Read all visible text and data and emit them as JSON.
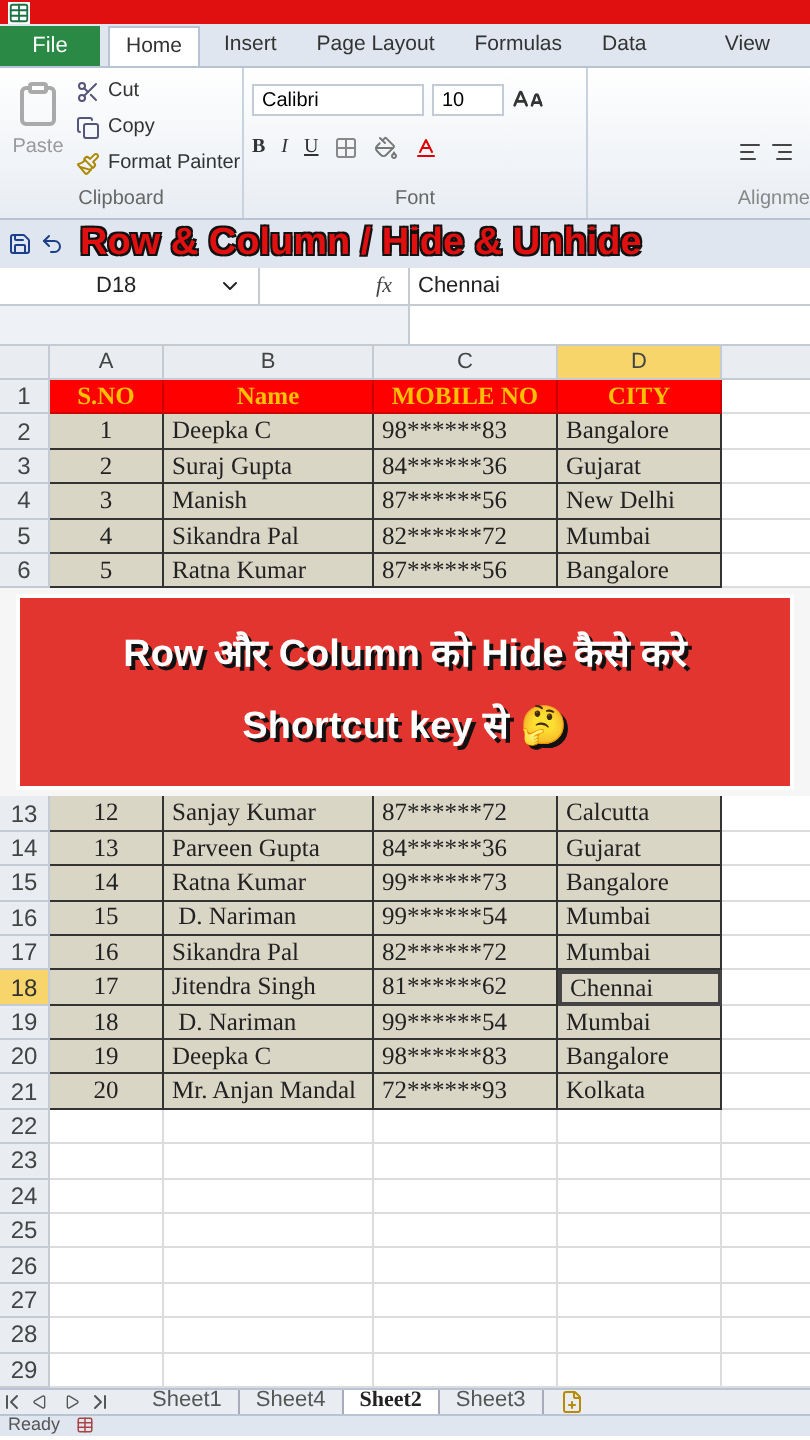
{
  "ribbon": {
    "tabs": [
      {
        "label": "File",
        "kind": "file",
        "selected": false
      },
      {
        "label": "Home",
        "kind": "tab",
        "selected": true
      },
      {
        "label": "Insert",
        "kind": "tab",
        "selected": false
      },
      {
        "label": "Page Layout",
        "kind": "tab",
        "selected": false
      },
      {
        "label": "Formulas",
        "kind": "tab",
        "selected": false
      },
      {
        "label": "Data",
        "kind": "tab",
        "selected": false
      },
      {
        "label": "View",
        "kind": "tab",
        "selected": false
      }
    ],
    "clipboard": {
      "paste": "Paste",
      "cut": "Cut",
      "copy": "Copy",
      "format_painter": "Format Painter",
      "label": "Clipboard"
    },
    "font": {
      "name": "Calibri",
      "size": "10",
      "bold": "B",
      "italic": "I",
      "underline": "U",
      "label": "Font"
    },
    "alignment_label": "Alignme"
  },
  "video_title": "Row & Column / Hide & Unhide",
  "formula_bar": {
    "name_box": "D18",
    "fx": "fx",
    "value": "Chennai"
  },
  "columns": [
    {
      "label": "A",
      "selected": false
    },
    {
      "label": "B",
      "selected": false
    },
    {
      "label": "C",
      "selected": false
    },
    {
      "label": "D",
      "selected": true
    }
  ],
  "rows_top": [
    {
      "number": "1",
      "kind": "header",
      "selected": false,
      "cells": [
        "S.NO",
        "Name",
        "MOBILE NO",
        "CITY"
      ]
    },
    {
      "number": "2",
      "kind": "data",
      "selected": false,
      "cells": [
        "1",
        "Deepka C",
        "98******83",
        "Bangalore"
      ]
    },
    {
      "number": "3",
      "kind": "data",
      "selected": false,
      "cells": [
        "2",
        "Suraj Gupta",
        "84******36",
        "Gujarat"
      ]
    },
    {
      "number": "4",
      "kind": "data",
      "selected": false,
      "cells": [
        "3",
        "Manish",
        "87******56",
        "New Delhi"
      ]
    },
    {
      "number": "5",
      "kind": "data",
      "selected": false,
      "cells": [
        "4",
        "Sikandra Pal",
        "82******72",
        "Mumbai"
      ]
    },
    {
      "number": "6",
      "kind": "data",
      "selected": false,
      "cells": [
        "5",
        "Ratna Kumar",
        "87******56",
        "Bangalore"
      ]
    }
  ],
  "banner": {
    "line_1": "Row और Column को Hide कैसे करे",
    "line_2": "Shortcut key से 🤔"
  },
  "rows_bottom": [
    {
      "number": "13",
      "kind": "data",
      "selected": false,
      "cells": [
        "12",
        "Sanjay Kumar",
        "87******72",
        "Calcutta"
      ]
    },
    {
      "number": "14",
      "kind": "data",
      "selected": false,
      "cells": [
        "13",
        "Parveen Gupta",
        "84******36",
        "Gujarat"
      ]
    },
    {
      "number": "15",
      "kind": "data",
      "selected": false,
      "cells": [
        "14",
        "Ratna Kumar",
        "99******73",
        "Bangalore"
      ]
    },
    {
      "number": "16",
      "kind": "data",
      "selected": false,
      "cells": [
        "15",
        " D. Nariman",
        "99******54",
        "Mumbai"
      ]
    },
    {
      "number": "17",
      "kind": "data",
      "selected": false,
      "cells": [
        "16",
        "Sikandra Pal",
        "82******72",
        "Mumbai"
      ]
    },
    {
      "number": "18",
      "kind": "data",
      "selected": true,
      "cells": [
        "17",
        "Jitendra Singh",
        "81******62",
        "Chennai"
      ]
    },
    {
      "number": "19",
      "kind": "data",
      "selected": false,
      "cells": [
        "18",
        " D. Nariman",
        "99******54",
        "Mumbai"
      ]
    },
    {
      "number": "20",
      "kind": "data",
      "selected": false,
      "cells": [
        "19",
        "Deepka C",
        "98******83",
        "Bangalore"
      ]
    },
    {
      "number": "21",
      "kind": "data",
      "selected": false,
      "cells": [
        "20",
        "Mr. Anjan Mandal",
        "72******93",
        "Kolkata"
      ]
    },
    {
      "number": "22",
      "kind": "empty",
      "selected": false
    },
    {
      "number": "23",
      "kind": "empty",
      "selected": false
    },
    {
      "number": "24",
      "kind": "empty",
      "selected": false
    },
    {
      "number": "25",
      "kind": "empty",
      "selected": false
    },
    {
      "number": "26",
      "kind": "empty",
      "selected": false
    },
    {
      "number": "27",
      "kind": "empty",
      "selected": false
    },
    {
      "number": "28",
      "kind": "empty",
      "selected": false
    },
    {
      "number": "29",
      "kind": "empty",
      "selected": false
    }
  ],
  "sheet_tabs": [
    {
      "label": "Sheet1",
      "selected": false
    },
    {
      "label": "Sheet4",
      "selected": false
    },
    {
      "label": "Sheet2",
      "selected": true
    },
    {
      "label": "Sheet3",
      "selected": false
    }
  ],
  "status": "Ready"
}
